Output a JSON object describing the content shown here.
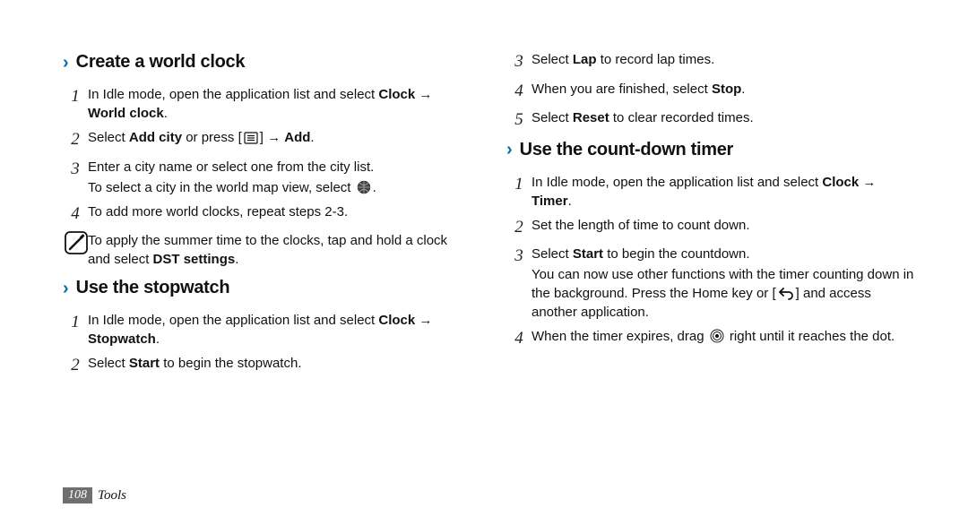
{
  "footer": {
    "page": "108",
    "chapter": "Tools"
  },
  "sections": [
    {
      "title": "Create a world clock",
      "steps": [
        {
          "num": "1",
          "parts": [
            "In Idle mode, open the application list and select ",
            {
              "b": "Clock"
            },
            " → ",
            {
              "b": "World clock"
            },
            "."
          ]
        },
        {
          "num": "2",
          "parts": [
            "Select ",
            {
              "b": "Add city"
            },
            " or press [",
            {
              "icon": "menu-icon"
            },
            "] → ",
            {
              "b": "Add"
            },
            "."
          ]
        },
        {
          "num": "3",
          "parts": [
            "Enter a city name or select one from the city list."
          ],
          "sub": [
            "To select a city in the world map view, select ",
            {
              "icon": "globe-icon"
            },
            "."
          ]
        },
        {
          "num": "4",
          "parts": [
            "To add more world clocks, repeat steps 2-3."
          ]
        }
      ],
      "tip": {
        "parts": [
          "To apply the summer time to the clocks, tap and hold a clock and select ",
          {
            "b": "DST settings"
          },
          "."
        ]
      }
    },
    {
      "title": "Use the stopwatch",
      "steps": [
        {
          "num": "1",
          "parts": [
            "In Idle mode, open the application list and select ",
            {
              "b": "Clock"
            },
            " → ",
            {
              "b": "Stopwatch"
            },
            "."
          ]
        },
        {
          "num": "2",
          "parts": [
            "Select ",
            {
              "b": "Start"
            },
            " to begin the stopwatch."
          ]
        },
        {
          "num": "3",
          "parts": [
            "Select ",
            {
              "b": "Lap"
            },
            " to record lap times."
          ]
        },
        {
          "num": "4",
          "parts": [
            "When you are finished, select ",
            {
              "b": "Stop"
            },
            "."
          ]
        },
        {
          "num": "5",
          "parts": [
            "Select ",
            {
              "b": "Reset"
            },
            " to clear recorded times."
          ]
        }
      ]
    },
    {
      "title": "Use the count-down timer",
      "steps": [
        {
          "num": "1",
          "parts": [
            "In Idle mode, open the application list and select ",
            {
              "b": "Clock"
            },
            " → ",
            {
              "b": "Timer"
            },
            "."
          ]
        },
        {
          "num": "2",
          "parts": [
            "Set the length of time to count down."
          ]
        },
        {
          "num": "3",
          "parts": [
            "Select ",
            {
              "b": "Start"
            },
            " to begin the countdown."
          ],
          "sub": [
            "You can now use other functions with the timer counting down in the background. Press the Home key or [",
            {
              "icon": "back-icon"
            },
            "] and access another application."
          ]
        },
        {
          "num": "4",
          "parts": [
            "When the timer expires, drag ",
            {
              "icon": "drag-handle-icon"
            },
            " right until it reaches the dot."
          ]
        }
      ]
    }
  ]
}
